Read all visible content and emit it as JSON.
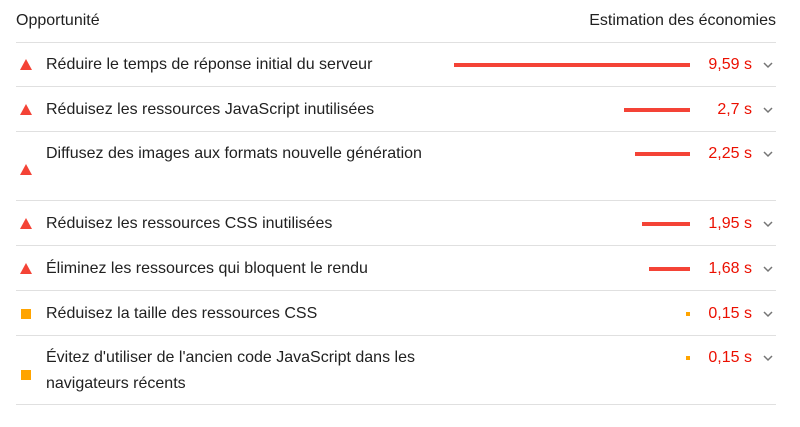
{
  "header": {
    "left": "Opportunité",
    "right": "Estimation des économies"
  },
  "colors": {
    "fail": "#f44336",
    "fail_text": "#eb0f00",
    "average": "#ffa400",
    "divider": "#e0e0e0"
  },
  "max_savings_s": 9.59,
  "opportunities": [
    {
      "title": "Réduire le temps de réponse initial du serveur",
      "savings": "9,59 s",
      "savings_s": 9.59,
      "severity": "fail",
      "icon": "warning-triangle-icon"
    },
    {
      "title": "Réduisez les ressources JavaScript inutilisées",
      "savings": "2,7 s",
      "savings_s": 2.7,
      "severity": "fail",
      "icon": "warning-triangle-icon"
    },
    {
      "title": "Diffusez des images aux formats nouvelle génération",
      "savings": "2,25 s",
      "savings_s": 2.25,
      "severity": "fail",
      "icon": "warning-triangle-icon"
    },
    {
      "title": "Réduisez les ressources CSS inutilisées",
      "savings": "1,95 s",
      "savings_s": 1.95,
      "severity": "fail",
      "icon": "warning-triangle-icon"
    },
    {
      "title": "Éliminez les ressources qui bloquent le rendu",
      "savings": "1,68 s",
      "savings_s": 1.68,
      "severity": "fail",
      "icon": "warning-triangle-icon"
    },
    {
      "title": "Réduisez la taille des ressources CSS",
      "savings": "0,15 s",
      "savings_s": 0.15,
      "severity": "average",
      "icon": "average-square-icon"
    },
    {
      "title": "Évitez d'utiliser de l'ancien code JavaScript dans les navigateurs récents",
      "savings": "0,15 s",
      "savings_s": 0.15,
      "severity": "average",
      "icon": "average-square-icon"
    }
  ]
}
